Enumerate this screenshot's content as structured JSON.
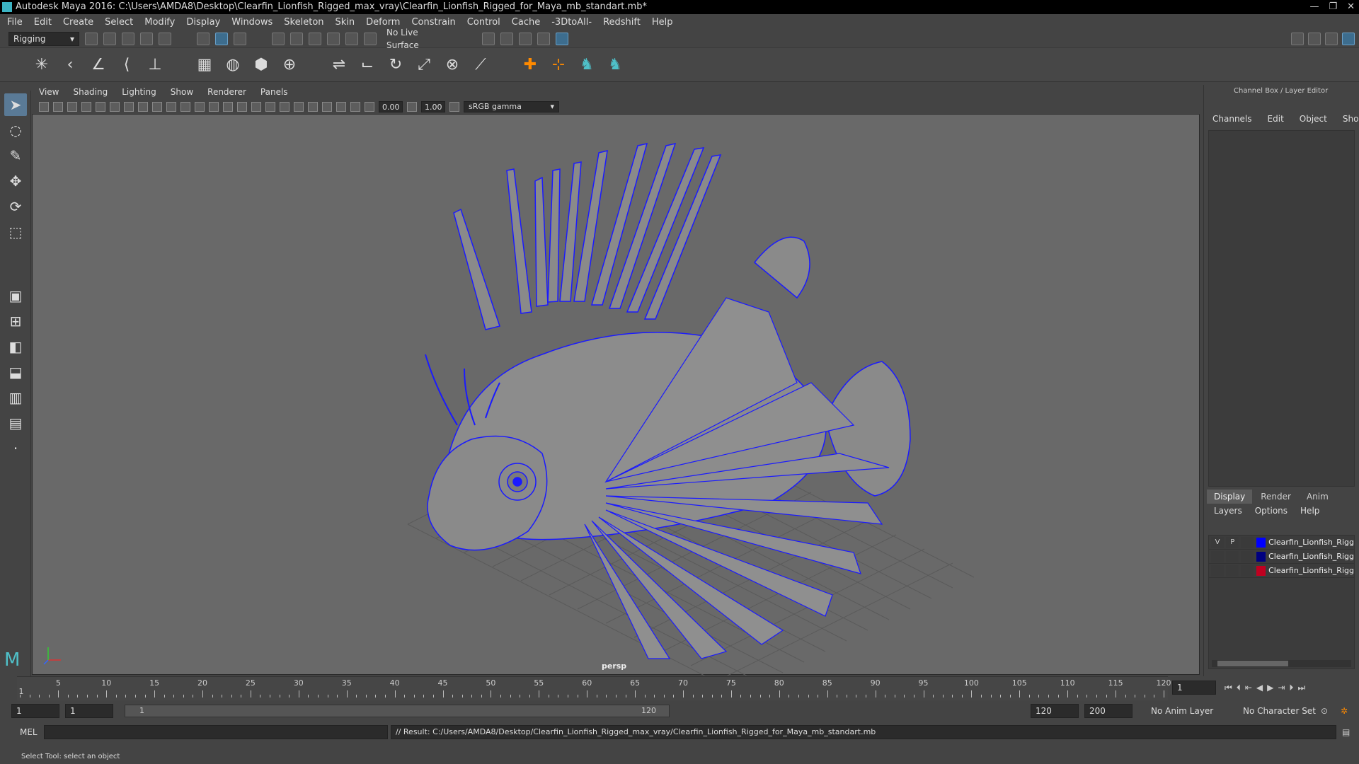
{
  "window": {
    "title": "Autodesk Maya 2016: C:\\Users\\AMDA8\\Desktop\\Clearfin_Lionfish_Rigged_max_vray\\Clearfin_Lionfish_Rigged_for_Maya_mb_standart.mb*",
    "controls": [
      "—",
      "❐",
      "✕"
    ]
  },
  "menubar": [
    "File",
    "Edit",
    "Create",
    "Select",
    "Modify",
    "Display",
    "Windows",
    "Skeleton",
    "Skin",
    "Deform",
    "Constrain",
    "Control",
    "Cache",
    "-3DtoAll-",
    "Redshift",
    "Help"
  ],
  "statusline": {
    "menuset": "Rigging",
    "live_surface": "No Live Surface"
  },
  "viewport": {
    "menus": [
      "View",
      "Shading",
      "Lighting",
      "Show",
      "Renderer",
      "Panels"
    ],
    "exposure": "0.00",
    "gamma": "1.00",
    "colorspace": "sRGB gamma",
    "camera_label": "persp"
  },
  "channelbox": {
    "title": "Channel Box / Layer Editor",
    "menus": [
      "Channels",
      "Edit",
      "Object",
      "Show"
    ],
    "layer_tabs": [
      "Display",
      "Render",
      "Anim"
    ],
    "layer_menus": [
      "Layers",
      "Options",
      "Help"
    ],
    "layers": [
      {
        "v": "V",
        "p": "P",
        "color": "#0000ff",
        "name": "Clearfin_Lionfish_Rigg"
      },
      {
        "v": "",
        "p": "",
        "color": "#000080",
        "name": "Clearfin_Lionfish_Rigg"
      },
      {
        "v": "",
        "p": "",
        "color": "#c00020",
        "name": "Clearfin_Lionfish_Rigg"
      }
    ]
  },
  "timeline": {
    "start_tick": "1",
    "ticks": [
      "5",
      "10",
      "15",
      "20",
      "25",
      "30",
      "35",
      "40",
      "45",
      "50",
      "55",
      "60",
      "65",
      "70",
      "75",
      "80",
      "85",
      "90",
      "95",
      "100",
      "105",
      "110",
      "115",
      "120"
    ],
    "current_frame": "1"
  },
  "range": {
    "start": "1",
    "playback_start": "1",
    "slider_start": "1",
    "slider_end": "120",
    "playback_end": "120",
    "end": "200",
    "anim_layer": "No Anim Layer",
    "character_set": "No Character Set"
  },
  "cmdline": {
    "lang": "MEL",
    "result": "// Result: C:/Users/AMDA8/Desktop/Clearfin_Lionfish_Rigged_max_vray/Clearfin_Lionfish_Rigged_for_Maya_mb_standart.mb"
  },
  "helpline": "Select Tool: select an object"
}
